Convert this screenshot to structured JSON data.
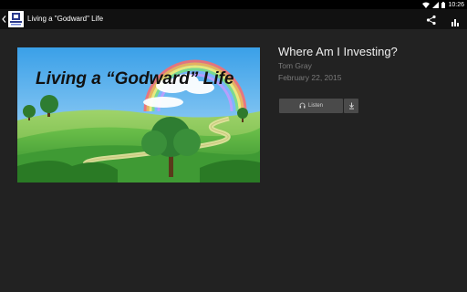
{
  "status_bar": {
    "time": "10:26",
    "icons": [
      "wifi-icon",
      "cellular-signal-icon",
      "battery-icon"
    ]
  },
  "app_bar": {
    "title": "Living a \"Godward\" Life",
    "icons": [
      "back-icon",
      "app-logo",
      "share-icon",
      "stats-icon"
    ]
  },
  "artwork": {
    "text": "Living a “Godward” Life"
  },
  "sermon": {
    "title": "Where Am I Investing?",
    "speaker": "Tom Gray",
    "date": "February 22, 2015"
  },
  "actions": {
    "listen_label": "Listen",
    "listen_icon": "headphones-icon",
    "download_icon": "download-icon"
  },
  "colors": {
    "background": "#222222",
    "app_bar": "#111111",
    "status_bar": "#000000",
    "button": "#4a4a4a",
    "muted_text": "#7a7a7a"
  }
}
